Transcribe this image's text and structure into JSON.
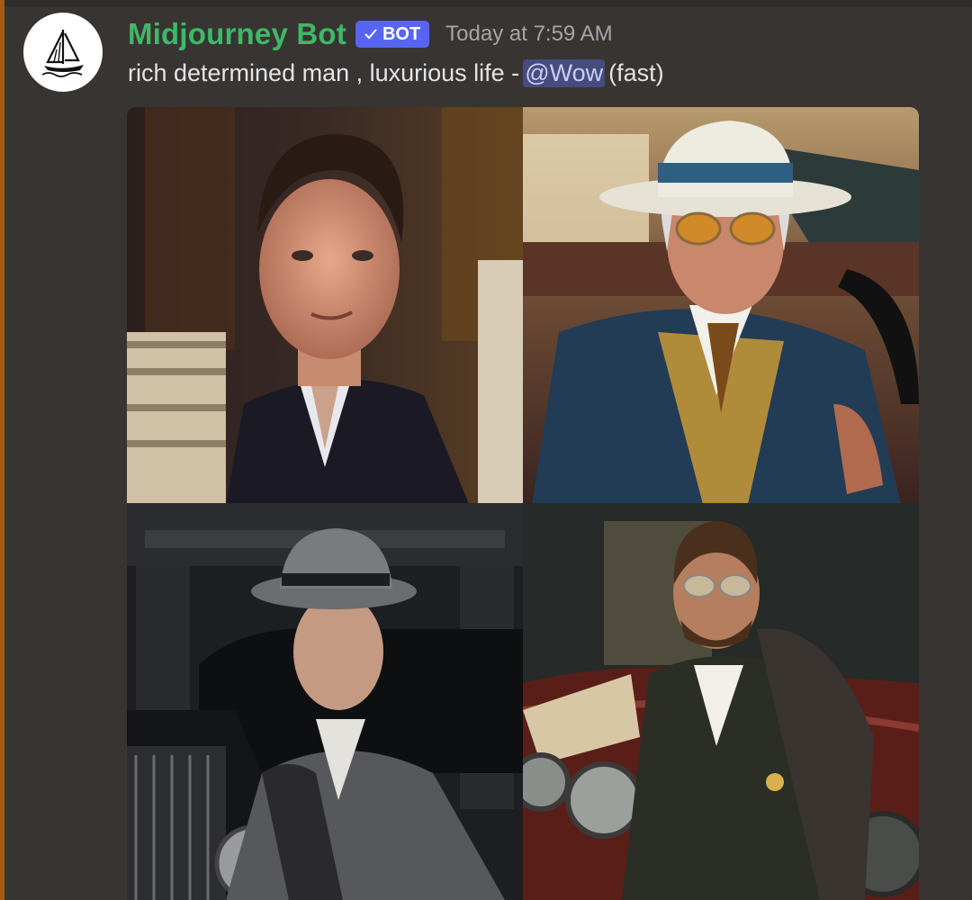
{
  "message": {
    "author": {
      "name": "Midjourney Bot",
      "badge": "BOT",
      "avatar_icon": "sailboat-icon",
      "name_color": "#3fb868"
    },
    "timestamp": "Today at 7:59 AM",
    "prompt": "rich determined man , luxurious life -",
    "mention": "@Wow",
    "mode": "(fast)",
    "images": [
      {
        "description": "young man in dark suit and patterned cravat beside stacks of cash"
      },
      {
        "description": "older man in white fedora and gold sunglasses in blue suit inside a car"
      },
      {
        "description": "man in gray bowler hat and gray coat standing by a vintage black car"
      },
      {
        "description": "bearded man in sunglasses and fur-trimmed coat leaning on a red classic car with money"
      }
    ]
  }
}
